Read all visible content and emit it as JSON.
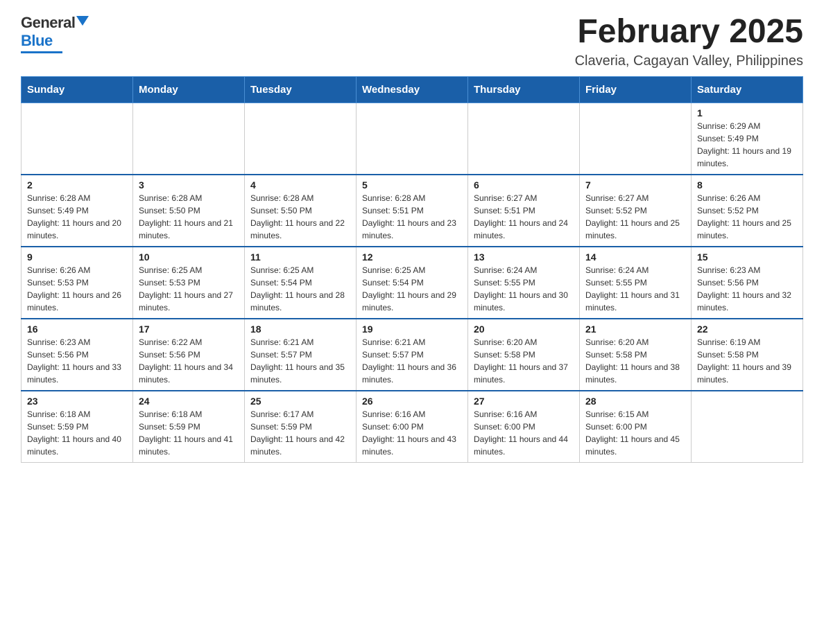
{
  "logo": {
    "general": "General",
    "blue": "Blue",
    "underline_color": "#1a73c9"
  },
  "header": {
    "month": "February 2025",
    "location": "Claveria, Cagayan Valley, Philippines"
  },
  "weekdays": [
    "Sunday",
    "Monday",
    "Tuesday",
    "Wednesday",
    "Thursday",
    "Friday",
    "Saturday"
  ],
  "weeks": [
    {
      "days": [
        {
          "num": "",
          "info": ""
        },
        {
          "num": "",
          "info": ""
        },
        {
          "num": "",
          "info": ""
        },
        {
          "num": "",
          "info": ""
        },
        {
          "num": "",
          "info": ""
        },
        {
          "num": "",
          "info": ""
        },
        {
          "num": "1",
          "info": "Sunrise: 6:29 AM\nSunset: 5:49 PM\nDaylight: 11 hours and 19 minutes."
        }
      ]
    },
    {
      "days": [
        {
          "num": "2",
          "info": "Sunrise: 6:28 AM\nSunset: 5:49 PM\nDaylight: 11 hours and 20 minutes."
        },
        {
          "num": "3",
          "info": "Sunrise: 6:28 AM\nSunset: 5:50 PM\nDaylight: 11 hours and 21 minutes."
        },
        {
          "num": "4",
          "info": "Sunrise: 6:28 AM\nSunset: 5:50 PM\nDaylight: 11 hours and 22 minutes."
        },
        {
          "num": "5",
          "info": "Sunrise: 6:28 AM\nSunset: 5:51 PM\nDaylight: 11 hours and 23 minutes."
        },
        {
          "num": "6",
          "info": "Sunrise: 6:27 AM\nSunset: 5:51 PM\nDaylight: 11 hours and 24 minutes."
        },
        {
          "num": "7",
          "info": "Sunrise: 6:27 AM\nSunset: 5:52 PM\nDaylight: 11 hours and 25 minutes."
        },
        {
          "num": "8",
          "info": "Sunrise: 6:26 AM\nSunset: 5:52 PM\nDaylight: 11 hours and 25 minutes."
        }
      ]
    },
    {
      "days": [
        {
          "num": "9",
          "info": "Sunrise: 6:26 AM\nSunset: 5:53 PM\nDaylight: 11 hours and 26 minutes."
        },
        {
          "num": "10",
          "info": "Sunrise: 6:25 AM\nSunset: 5:53 PM\nDaylight: 11 hours and 27 minutes."
        },
        {
          "num": "11",
          "info": "Sunrise: 6:25 AM\nSunset: 5:54 PM\nDaylight: 11 hours and 28 minutes."
        },
        {
          "num": "12",
          "info": "Sunrise: 6:25 AM\nSunset: 5:54 PM\nDaylight: 11 hours and 29 minutes."
        },
        {
          "num": "13",
          "info": "Sunrise: 6:24 AM\nSunset: 5:55 PM\nDaylight: 11 hours and 30 minutes."
        },
        {
          "num": "14",
          "info": "Sunrise: 6:24 AM\nSunset: 5:55 PM\nDaylight: 11 hours and 31 minutes."
        },
        {
          "num": "15",
          "info": "Sunrise: 6:23 AM\nSunset: 5:56 PM\nDaylight: 11 hours and 32 minutes."
        }
      ]
    },
    {
      "days": [
        {
          "num": "16",
          "info": "Sunrise: 6:23 AM\nSunset: 5:56 PM\nDaylight: 11 hours and 33 minutes."
        },
        {
          "num": "17",
          "info": "Sunrise: 6:22 AM\nSunset: 5:56 PM\nDaylight: 11 hours and 34 minutes."
        },
        {
          "num": "18",
          "info": "Sunrise: 6:21 AM\nSunset: 5:57 PM\nDaylight: 11 hours and 35 minutes."
        },
        {
          "num": "19",
          "info": "Sunrise: 6:21 AM\nSunset: 5:57 PM\nDaylight: 11 hours and 36 minutes."
        },
        {
          "num": "20",
          "info": "Sunrise: 6:20 AM\nSunset: 5:58 PM\nDaylight: 11 hours and 37 minutes."
        },
        {
          "num": "21",
          "info": "Sunrise: 6:20 AM\nSunset: 5:58 PM\nDaylight: 11 hours and 38 minutes."
        },
        {
          "num": "22",
          "info": "Sunrise: 6:19 AM\nSunset: 5:58 PM\nDaylight: 11 hours and 39 minutes."
        }
      ]
    },
    {
      "days": [
        {
          "num": "23",
          "info": "Sunrise: 6:18 AM\nSunset: 5:59 PM\nDaylight: 11 hours and 40 minutes."
        },
        {
          "num": "24",
          "info": "Sunrise: 6:18 AM\nSunset: 5:59 PM\nDaylight: 11 hours and 41 minutes."
        },
        {
          "num": "25",
          "info": "Sunrise: 6:17 AM\nSunset: 5:59 PM\nDaylight: 11 hours and 42 minutes."
        },
        {
          "num": "26",
          "info": "Sunrise: 6:16 AM\nSunset: 6:00 PM\nDaylight: 11 hours and 43 minutes."
        },
        {
          "num": "27",
          "info": "Sunrise: 6:16 AM\nSunset: 6:00 PM\nDaylight: 11 hours and 44 minutes."
        },
        {
          "num": "28",
          "info": "Sunrise: 6:15 AM\nSunset: 6:00 PM\nDaylight: 11 hours and 45 minutes."
        },
        {
          "num": "",
          "info": ""
        }
      ]
    }
  ]
}
